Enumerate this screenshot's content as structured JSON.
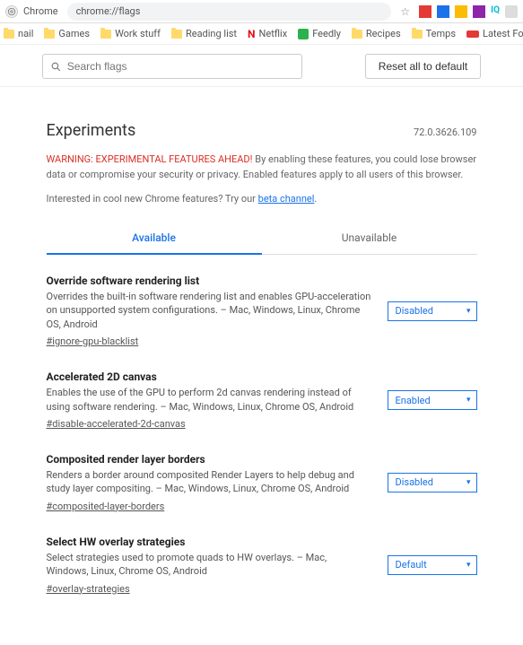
{
  "chrome": {
    "page_label": "Chrome",
    "url": "chrome://flags"
  },
  "bookmarks": [
    {
      "type": "folder",
      "label": "nail"
    },
    {
      "type": "folder",
      "label": "Games"
    },
    {
      "type": "folder",
      "label": "Work stuff"
    },
    {
      "type": "folder",
      "label": "Reading list"
    },
    {
      "type": "netflix",
      "label": "Netflix"
    },
    {
      "type": "feedly",
      "label": "Feedly"
    },
    {
      "type": "folder",
      "label": "Recipes"
    },
    {
      "type": "folder",
      "label": "Temps"
    },
    {
      "type": "lfn",
      "label": "Latest Football New…"
    }
  ],
  "search": {
    "placeholder": "Search flags"
  },
  "reset_label": "Reset all to default",
  "title": "Experiments",
  "version": "72.0.3626.109",
  "warning_prefix": "WARNING: EXPERIMENTAL FEATURES AHEAD!",
  "warning_rest": " By enabling these features, you could lose browser data or compromise your security or privacy. Enabled features apply to all users of this browser.",
  "interest_prefix": "Interested in cool new Chrome features? Try our ",
  "interest_link": "beta channel",
  "interest_suffix": ".",
  "tabs": {
    "available": "Available",
    "unavailable": "Unavailable"
  },
  "flags": [
    {
      "title": "Override software rendering list",
      "desc": "Overrides the built-in software rendering list and enables GPU-acceleration on unsupported system configurations. – Mac, Windows, Linux, Chrome OS, Android",
      "anchor": "#ignore-gpu-blacklist",
      "value": "Disabled"
    },
    {
      "title": "Accelerated 2D canvas",
      "desc": "Enables the use of the GPU to perform 2d canvas rendering instead of using software rendering. – Mac, Windows, Linux, Chrome OS, Android",
      "anchor": "#disable-accelerated-2d-canvas",
      "value": "Enabled"
    },
    {
      "title": "Composited render layer borders",
      "desc": "Renders a border around composited Render Layers to help debug and study layer compositing. – Mac, Windows, Linux, Chrome OS, Android",
      "anchor": "#composited-layer-borders",
      "value": "Disabled"
    },
    {
      "title": "Select HW overlay strategies",
      "desc": "Select strategies used to promote quads to HW overlays. – Mac, Windows, Linux, Chrome OS, Android",
      "anchor": "#overlay-strategies",
      "value": "Default"
    }
  ]
}
